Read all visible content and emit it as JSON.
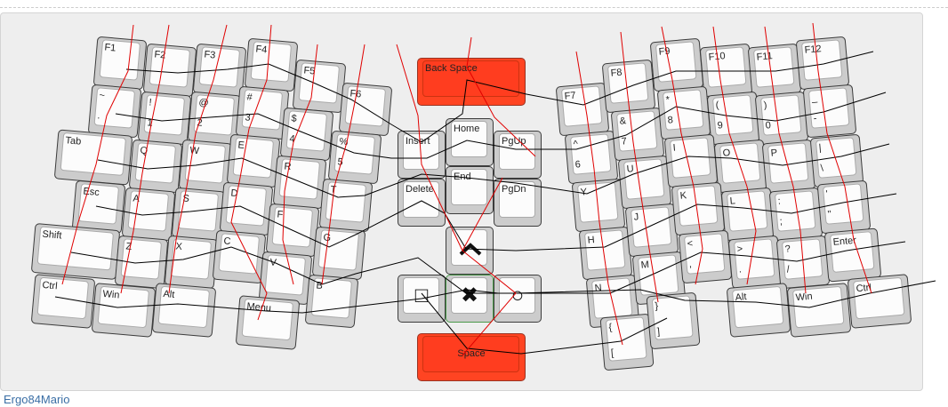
{
  "layout_name": "Ergo84Mario",
  "symbols": {
    "square": "□",
    "cross": "✖",
    "circle": "○"
  },
  "keys": {
    "f1": "F1",
    "f2": "F2",
    "f3": "F3",
    "f4": "F4",
    "f5": "F5",
    "f6": "F6",
    "tilde_top": "~",
    "tilde_bot": ".",
    "excl_top": "!",
    "excl_bot": "1",
    "at_top": "@",
    "at_bot": "2",
    "hash_top": "#",
    "hash_bot": "3",
    "dollar_top": "$",
    "dollar_bot": "4",
    "pct_top": "%",
    "pct_bot": "5",
    "tab": "Tab",
    "q": "Q",
    "w": "W",
    "e": "E",
    "r": "R",
    "t": "T",
    "esc": "Esc",
    "a": "A",
    "s": "S",
    "d": "D",
    "f": "F",
    "g": "G",
    "shift": "Shift",
    "z": "Z",
    "x": "X",
    "c": "C",
    "v": "V",
    "b": "B",
    "lctrl": "Ctrl",
    "lwin": "Win",
    "lalt": "Alt",
    "menu": "Menu",
    "backspace": "Back Space",
    "insert": "Insert",
    "home": "Home",
    "pgup": "PgUp",
    "delete": "Delete",
    "end": "End",
    "pgdn": "PgDn",
    "space": "Space",
    "f7": "F7",
    "f8": "F8",
    "f9": "F9",
    "f10": "F10",
    "f11": "F11",
    "f12": "F12",
    "caret_top": "^",
    "caret_bot": "6",
    "amp_top": "&",
    "amp_bot": "7",
    "star_top": "*",
    "star_bot": "8",
    "lparen_top": "(",
    "lparen_bot": "9",
    "rparen_top": ")",
    "rparen_bot": "0",
    "minus_top": "_",
    "minus_bot": "-",
    "y": "Y",
    "u": "U",
    "i": "I",
    "o": "O",
    "p": "P",
    "pipe_top": "|",
    "pipe_bot": "\\",
    "h": "H",
    "j": "J",
    "k": "K",
    "l": "L",
    "colon_top": ":",
    "colon_bot": ";",
    "quote_top": "'",
    "quote_bot": "\"",
    "n": "N",
    "m": "M",
    "lt_top": "<",
    "lt_bot": ",",
    "gt_top": ">",
    "gt_bot": ".",
    "q_top": "?",
    "q_bot": "/",
    "enter": "Enter",
    "lbrace_top": "{",
    "lbrace_bot": "[",
    "rbrace_top": "}",
    "rbrace_bot": "]",
    "ralt": "Alt",
    "rwin": "Win",
    "rctrl": "Ctrl"
  },
  "colors": {
    "highlight_key": "#ff3d1f",
    "black_path": "#000000",
    "red_path": "#e00000",
    "caption_link": "#3a6ea5"
  }
}
